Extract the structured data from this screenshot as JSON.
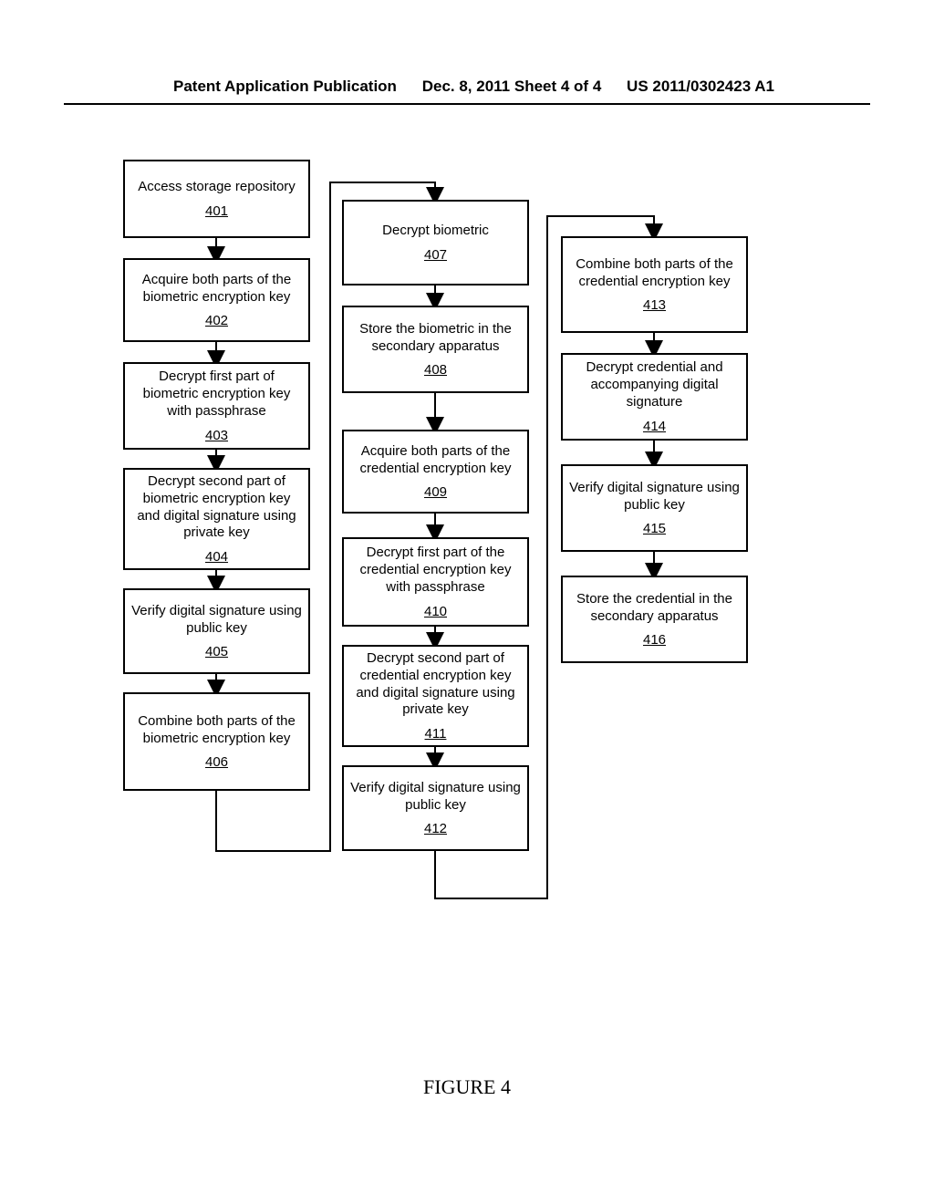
{
  "header": {
    "left": "Patent Application Publication",
    "center": "Dec. 8, 2011   Sheet 4 of 4",
    "right": "US 2011/0302423 A1"
  },
  "figure_caption": "FIGURE 4",
  "boxes": {
    "b401": {
      "text": "Access storage repository",
      "ref": "401"
    },
    "b402": {
      "text": "Acquire both parts of the biometric encryption key",
      "ref": "402"
    },
    "b403": {
      "text": "Decrypt first part of biometric encryption key with passphrase",
      "ref": "403"
    },
    "b404": {
      "text": "Decrypt second part of biometric encryption key and digital signature using private key",
      "ref": "404"
    },
    "b405": {
      "text": "Verify digital signature using public key",
      "ref": "405"
    },
    "b406": {
      "text": "Combine both parts of the biometric encryption key",
      "ref": "406"
    },
    "b407": {
      "text": "Decrypt biometric",
      "ref": "407"
    },
    "b408": {
      "text": "Store the biometric in the secondary apparatus",
      "ref": "408"
    },
    "b409": {
      "text": "Acquire both parts of the credential encryption key",
      "ref": "409"
    },
    "b410": {
      "text": "Decrypt first part of the credential encryption key with passphrase",
      "ref": "410"
    },
    "b411": {
      "text": "Decrypt second part of credential encryption key and digital signature using private key",
      "ref": "411"
    },
    "b412": {
      "text": "Verify digital signature using public key",
      "ref": "412"
    },
    "b413": {
      "text": "Combine both parts of the credential encryption key",
      "ref": "413"
    },
    "b414": {
      "text": "Decrypt credential and accompanying digital signature",
      "ref": "414"
    },
    "b415": {
      "text": "Verify digital signature using public key",
      "ref": "415"
    },
    "b416": {
      "text": "Store the credential in the secondary apparatus",
      "ref": "416"
    }
  }
}
